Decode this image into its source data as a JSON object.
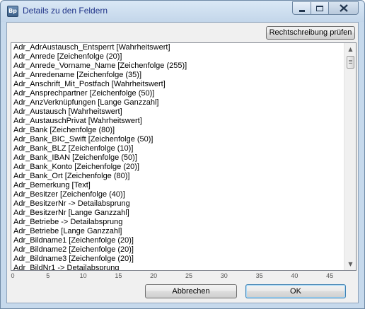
{
  "window": {
    "title": "Details zu den Feldern",
    "app_icon_text": "Bp"
  },
  "toolbar": {
    "spellcheck_label": "Rechtschreibung prüfen"
  },
  "fields": [
    "Adr_AdrAustausch_Entsperrt [Wahrheitswert]",
    "Adr_Anrede [Zeichenfolge (20)]",
    "Adr_Anrede_Vorname_Name [Zeichenfolge (255)]",
    "Adr_Anredename [Zeichenfolge (35)]",
    "Adr_Anschrift_Mit_Postfach [Wahrheitswert]",
    "Adr_Ansprechpartner [Zeichenfolge (50)]",
    "Adr_AnzVerknüpfungen [Lange Ganzzahl]",
    "Adr_Austausch [Wahrheitswert]",
    "Adr_AustauschPrivat [Wahrheitswert]",
    "Adr_Bank [Zeichenfolge (80)]",
    "Adr_Bank_BIC_Swift [Zeichenfolge (50)]",
    "Adr_Bank_BLZ [Zeichenfolge (10)]",
    "Adr_Bank_IBAN [Zeichenfolge (50)]",
    "Adr_Bank_Konto [Zeichenfolge (20)]",
    "Adr_Bank_Ort [Zeichenfolge (80)]",
    "Adr_Bemerkung [Text]",
    "Adr_Besitzer [Zeichenfolge (40)]",
    "Adr_BesitzerNr -> Detailabsprung",
    "Adr_BesitzerNr [Lange Ganzzahl]",
    "Adr_Betriebe -> Detailabsprung",
    "Adr_Betriebe [Lange Ganzzahl]",
    "Adr_Bildname1 [Zeichenfolge (20)]",
    "Adr_Bildname2 [Zeichenfolge (20)]",
    "Adr_Bildname3 [Zeichenfolge (20)]",
    "Adr_BildNr1 -> Detailabsprung"
  ],
  "ruler": [
    "0",
    "5",
    "10",
    "15",
    "20",
    "25",
    "30",
    "35",
    "40",
    "45"
  ],
  "buttons": {
    "cancel_label": "Abbrechen",
    "ok_label": "OK"
  },
  "icons": {
    "scroll_up": "scroll-up-arrow-icon",
    "scroll_down": "scroll-down-arrow-icon"
  }
}
